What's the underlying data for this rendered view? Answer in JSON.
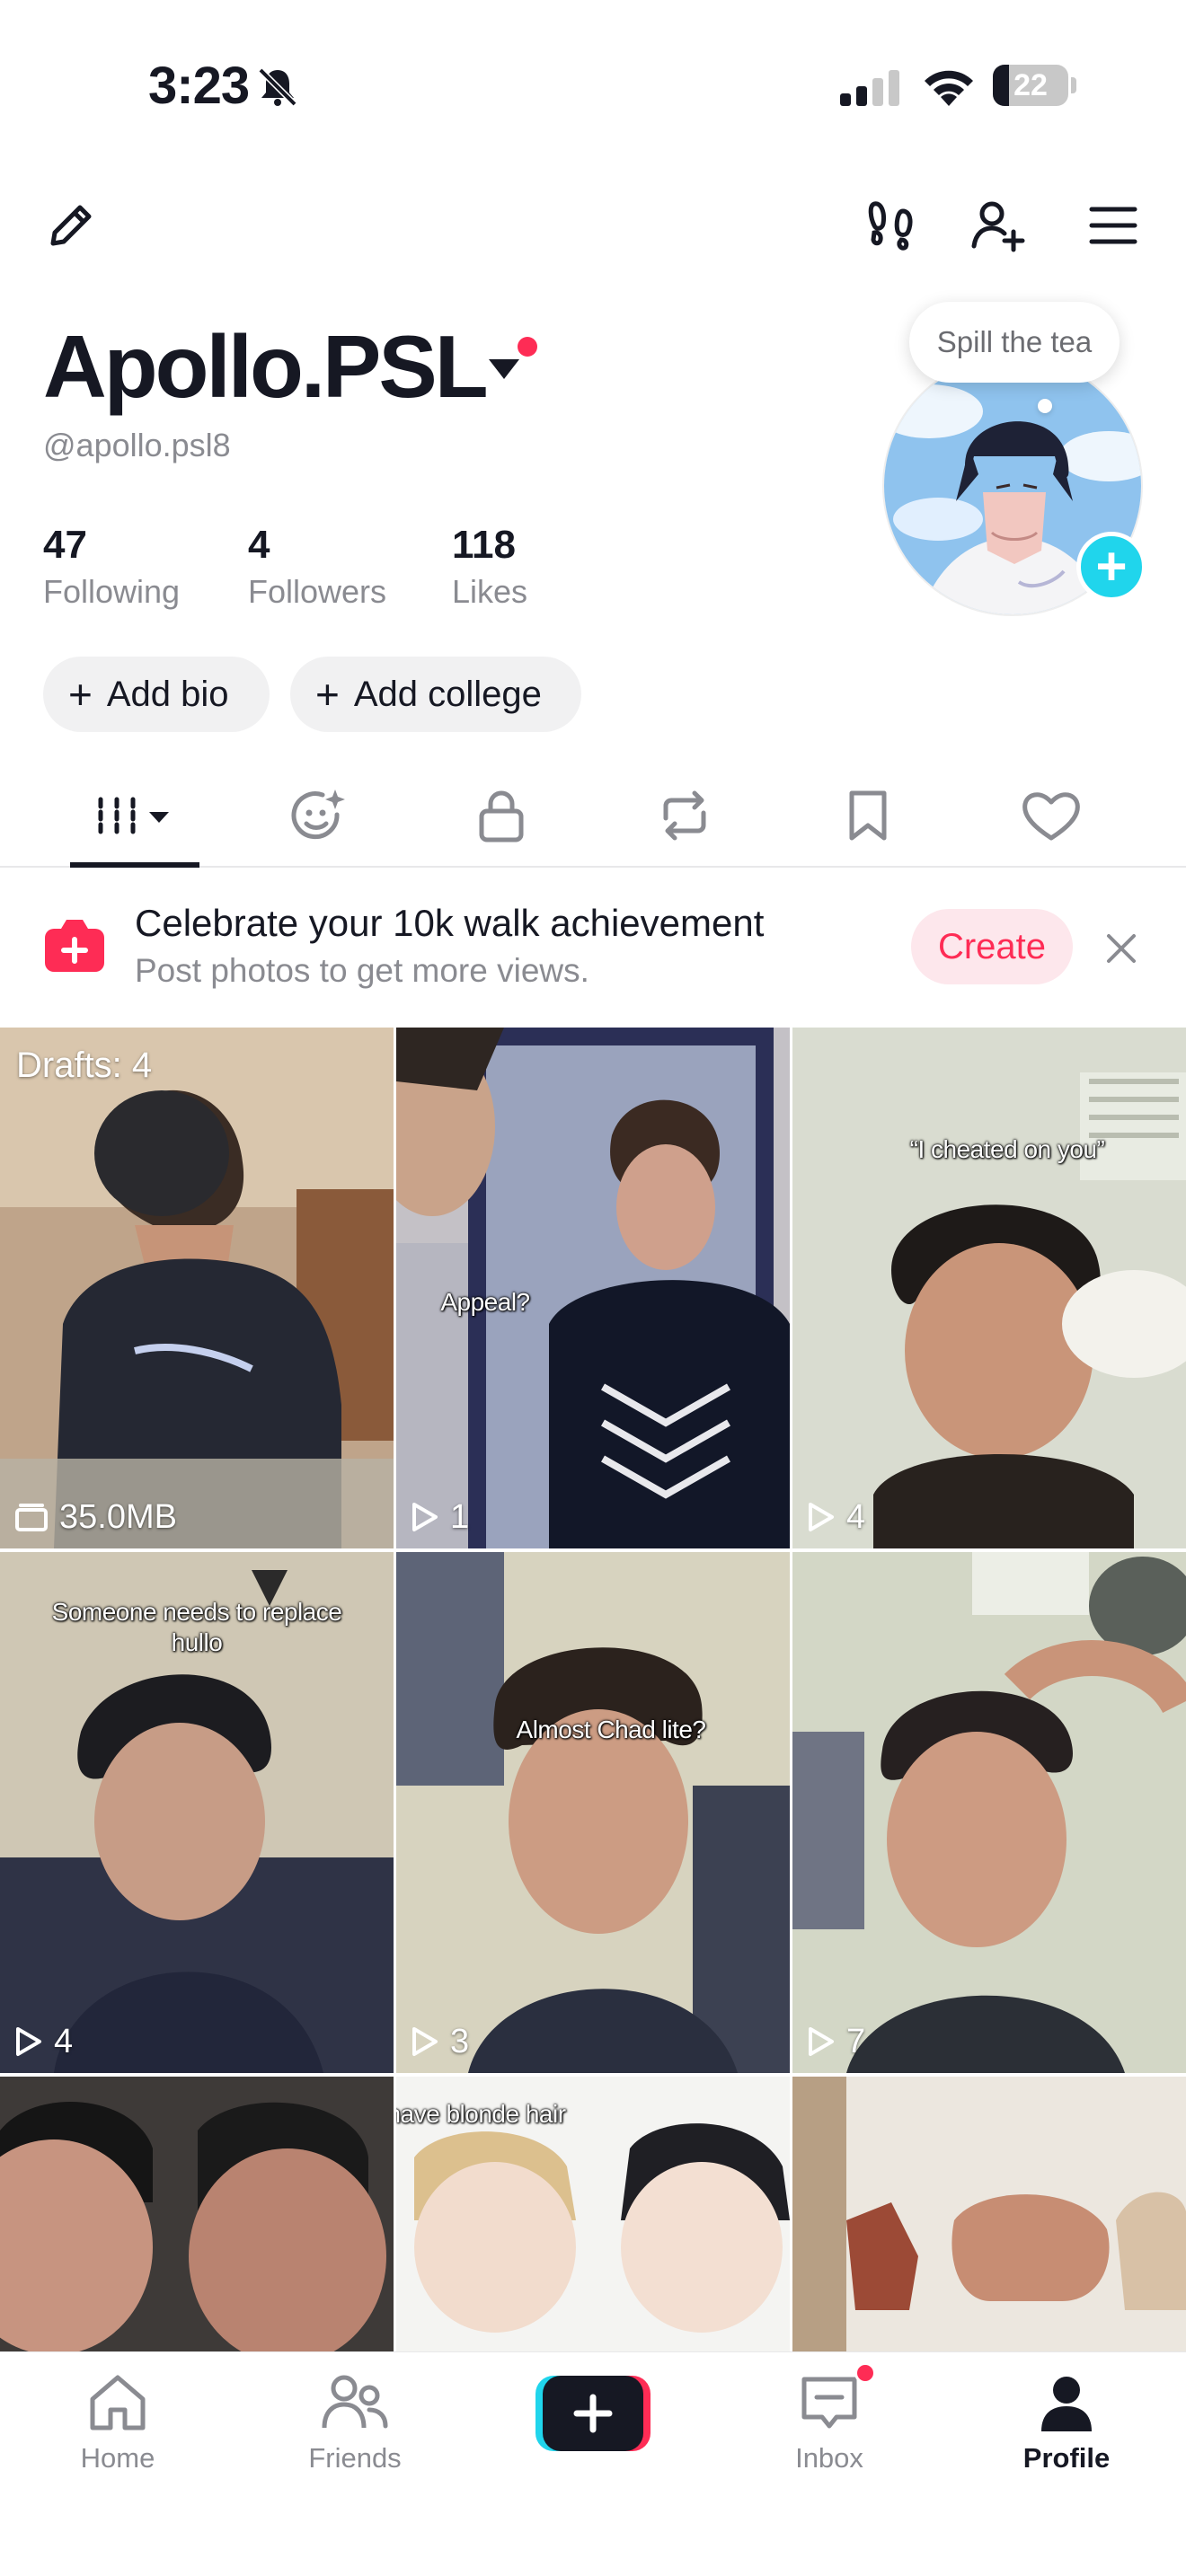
{
  "status_bar": {
    "time": "3:23",
    "battery": "22",
    "battery_level": 0.22
  },
  "header": {
    "edit_icon": "pencil-icon",
    "footprints_icon": "footprints-icon",
    "add_friend_icon": "add-user-icon",
    "menu_icon": "hamburger-menu-icon"
  },
  "profile": {
    "display_name": "Apollo.PSL",
    "username": "@apollo.psl8",
    "bubble_text": "Spill the tea",
    "stats": [
      {
        "value": "47",
        "label": "Following"
      },
      {
        "value": "4",
        "label": "Followers"
      },
      {
        "value": "118",
        "label": "Likes"
      }
    ],
    "add_bio": "Add bio",
    "add_college": "Add college"
  },
  "tabs": [
    "videos",
    "reposts-ai-avatar",
    "private",
    "reposts",
    "favorites",
    "liked"
  ],
  "promo": {
    "title": "Celebrate your 10k walk achievement",
    "subtitle": "Post photos to get more views.",
    "create_label": "Create"
  },
  "grid": {
    "drafts_label": "Drafts: 4",
    "drafts_size": "35.0MB",
    "items": [
      {
        "caption": "",
        "views": ""
      },
      {
        "caption": "Appeal?",
        "views": "1"
      },
      {
        "caption": "“I cheated on you”",
        "views": "4"
      },
      {
        "caption": "Someone needs to replace\nhullo",
        "views": "4"
      },
      {
        "caption": "Almost Chad lite?",
        "views": "3"
      },
      {
        "caption": "",
        "views": "7"
      },
      {
        "caption": "",
        "views": ""
      },
      {
        "caption": "have blonde hair",
        "views": ""
      },
      {
        "caption": "",
        "views": ""
      }
    ]
  },
  "bottom_nav": {
    "home": "Home",
    "friends": "Friends",
    "inbox": "Inbox",
    "profile": "Profile"
  },
  "colors": {
    "accent": "#fe2c55",
    "cyan": "#20d5ec",
    "text": "#161823",
    "muted": "#8a8b91"
  }
}
